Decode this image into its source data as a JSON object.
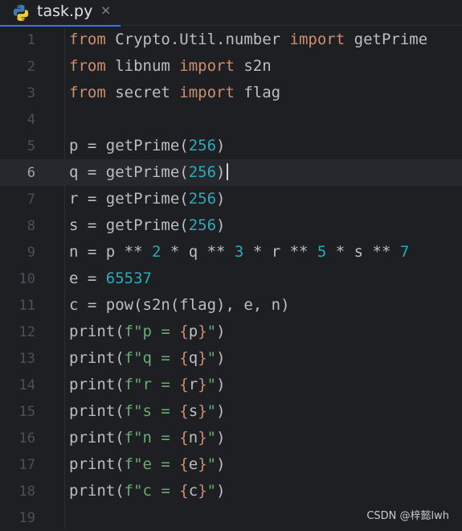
{
  "tab": {
    "label": "task.py",
    "close": "×",
    "icon": "python-icon"
  },
  "editor": {
    "current_line": 6,
    "lines": [
      {
        "n": "1",
        "tokens": [
          [
            "kw",
            "from"
          ],
          [
            "t",
            " Crypto.Util.number "
          ],
          [
            "kw",
            "import"
          ],
          [
            "t",
            " getPrime"
          ]
        ]
      },
      {
        "n": "2",
        "tokens": [
          [
            "kw",
            "from"
          ],
          [
            "t",
            " libnum "
          ],
          [
            "kw",
            "import"
          ],
          [
            "t",
            " s2n"
          ]
        ]
      },
      {
        "n": "3",
        "tokens": [
          [
            "kw",
            "from"
          ],
          [
            "t",
            " secret "
          ],
          [
            "kw",
            "import"
          ],
          [
            "t",
            " flag"
          ]
        ]
      },
      {
        "n": "4",
        "tokens": []
      },
      {
        "n": "5",
        "tokens": [
          [
            "t",
            "p = getPrime("
          ],
          [
            "num",
            "256"
          ],
          [
            "t",
            ")"
          ]
        ]
      },
      {
        "n": "6",
        "tokens": [
          [
            "t",
            "q = getPrime("
          ],
          [
            "num",
            "256"
          ],
          [
            "t",
            ")"
          ],
          [
            "caret",
            ""
          ]
        ]
      },
      {
        "n": "7",
        "tokens": [
          [
            "t",
            "r = getPrime("
          ],
          [
            "num",
            "256"
          ],
          [
            "t",
            ")"
          ]
        ]
      },
      {
        "n": "8",
        "tokens": [
          [
            "t",
            "s = getPrime("
          ],
          [
            "num",
            "256"
          ],
          [
            "t",
            ")"
          ]
        ]
      },
      {
        "n": "9",
        "tokens": [
          [
            "t",
            "n = p ** "
          ],
          [
            "num",
            "2"
          ],
          [
            "t",
            " * q ** "
          ],
          [
            "num",
            "3"
          ],
          [
            "t",
            " * r ** "
          ],
          [
            "num",
            "5"
          ],
          [
            "t",
            " * s ** "
          ],
          [
            "num",
            "7"
          ]
        ]
      },
      {
        "n": "10",
        "tokens": [
          [
            "t",
            "e = "
          ],
          [
            "num",
            "65537"
          ]
        ]
      },
      {
        "n": "11",
        "tokens": [
          [
            "t",
            "c = pow(s2n(flag), e, n)"
          ]
        ]
      },
      {
        "n": "12",
        "tokens": [
          [
            "t",
            "print("
          ],
          [
            "str",
            "f\"p = "
          ],
          [
            "brace",
            "{"
          ],
          [
            "t",
            "p"
          ],
          [
            "brace",
            "}"
          ],
          [
            "str",
            "\""
          ],
          [
            "t",
            ")"
          ]
        ]
      },
      {
        "n": "13",
        "tokens": [
          [
            "t",
            "print("
          ],
          [
            "str",
            "f\"q = "
          ],
          [
            "brace",
            "{"
          ],
          [
            "t",
            "q"
          ],
          [
            "brace",
            "}"
          ],
          [
            "str",
            "\""
          ],
          [
            "t",
            ")"
          ]
        ]
      },
      {
        "n": "14",
        "tokens": [
          [
            "t",
            "print("
          ],
          [
            "str",
            "f\"r = "
          ],
          [
            "brace",
            "{"
          ],
          [
            "t",
            "r"
          ],
          [
            "brace",
            "}"
          ],
          [
            "str",
            "\""
          ],
          [
            "t",
            ")"
          ]
        ]
      },
      {
        "n": "15",
        "tokens": [
          [
            "t",
            "print("
          ],
          [
            "str",
            "f\"s = "
          ],
          [
            "brace",
            "{"
          ],
          [
            "t",
            "s"
          ],
          [
            "brace",
            "}"
          ],
          [
            "str",
            "\""
          ],
          [
            "t",
            ")"
          ]
        ]
      },
      {
        "n": "16",
        "tokens": [
          [
            "t",
            "print("
          ],
          [
            "str",
            "f\"n = "
          ],
          [
            "brace",
            "{"
          ],
          [
            "t",
            "n"
          ],
          [
            "brace",
            "}"
          ],
          [
            "str",
            "\""
          ],
          [
            "t",
            ")"
          ]
        ]
      },
      {
        "n": "17",
        "tokens": [
          [
            "t",
            "print("
          ],
          [
            "str",
            "f\"e = "
          ],
          [
            "brace",
            "{"
          ],
          [
            "t",
            "e"
          ],
          [
            "brace",
            "}"
          ],
          [
            "str",
            "\""
          ],
          [
            "t",
            ")"
          ]
        ]
      },
      {
        "n": "18",
        "tokens": [
          [
            "t",
            "print("
          ],
          [
            "str",
            "f\"c = "
          ],
          [
            "brace",
            "{"
          ],
          [
            "t",
            "c"
          ],
          [
            "brace",
            "}"
          ],
          [
            "str",
            "\""
          ],
          [
            "t",
            ")"
          ]
        ]
      },
      {
        "n": "19",
        "tokens": []
      }
    ]
  },
  "watermark": "CSDN @梓懿lwh",
  "colors": {
    "background": "#1e1f22",
    "keyword": "#cf8e6d",
    "number": "#2aacb8",
    "string": "#6aab73",
    "text": "#bcbec4",
    "line_number": "#4b5059",
    "tab_underline": "#3574f0"
  }
}
